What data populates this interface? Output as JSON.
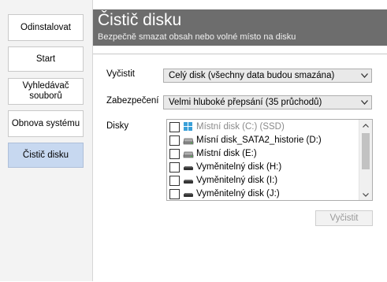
{
  "sidebar": {
    "items": [
      {
        "label": "Odinstalovat",
        "active": false
      },
      {
        "label": "Start",
        "active": false
      },
      {
        "label": "Vyhledávač\nsouborů",
        "active": false
      },
      {
        "label": "Obnova systému",
        "active": false
      },
      {
        "label": "Čistič disku",
        "active": true
      }
    ]
  },
  "header": {
    "title": "Čistič disku",
    "subtitle": "Bezpečně smazat obsah nebo volné místo na disku",
    "bg_color": "#6d6d6d"
  },
  "form": {
    "clean_label": "Vyčistit",
    "clean_value": "Celý disk (všechny data budou smazána)",
    "security_label": "Zabezpečení",
    "security_value": "Velmi hluboké přepsání (35 průchodů)",
    "disks_label": "Disky"
  },
  "disks": [
    {
      "label": "Místní disk (C:) (SSD)",
      "icon": "windows-drive-icon",
      "disabled": true,
      "checked": false
    },
    {
      "label": "Mísní disk_SATA2_historie (D:)",
      "icon": "hard-drive-icon",
      "disabled": false,
      "checked": false
    },
    {
      "label": "Místní disk (E:)",
      "icon": "hard-drive-icon",
      "disabled": false,
      "checked": false
    },
    {
      "label": "Vyměnitelný disk (H:)",
      "icon": "removable-drive-icon",
      "disabled": false,
      "checked": false
    },
    {
      "label": "Vyměnitelný disk (I:)",
      "icon": "removable-drive-icon",
      "disabled": false,
      "checked": false
    },
    {
      "label": "Vyměnitelný disk (J:)",
      "icon": "removable-drive-icon",
      "disabled": false,
      "checked": false
    }
  ],
  "actions": {
    "clean_button": "Vyčistit",
    "clean_button_enabled": false
  },
  "colors": {
    "active_nav": "#c7d8f0",
    "header": "#6d6d6d"
  }
}
